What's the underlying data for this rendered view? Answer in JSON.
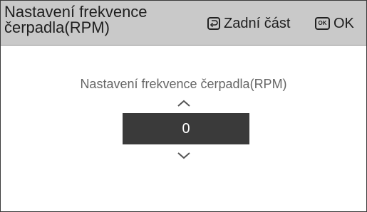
{
  "header": {
    "title": "Nastavení frekvence čerpadla(RPM)",
    "back_label": "Zadní část",
    "ok_icon_text": "OK",
    "ok_label": "OK",
    "back_icon": "return-icon",
    "ok_icon": "ok-key-icon"
  },
  "main": {
    "field_label": "Nastavení frekvence čerpadla(RPM)",
    "value": "0",
    "increase_icon": "chevron-up-icon",
    "decrease_icon": "chevron-down-icon"
  },
  "colors": {
    "header_bg": "#c9c9c9",
    "value_box_bg": "#3a3a3a",
    "label_text": "#666666"
  }
}
